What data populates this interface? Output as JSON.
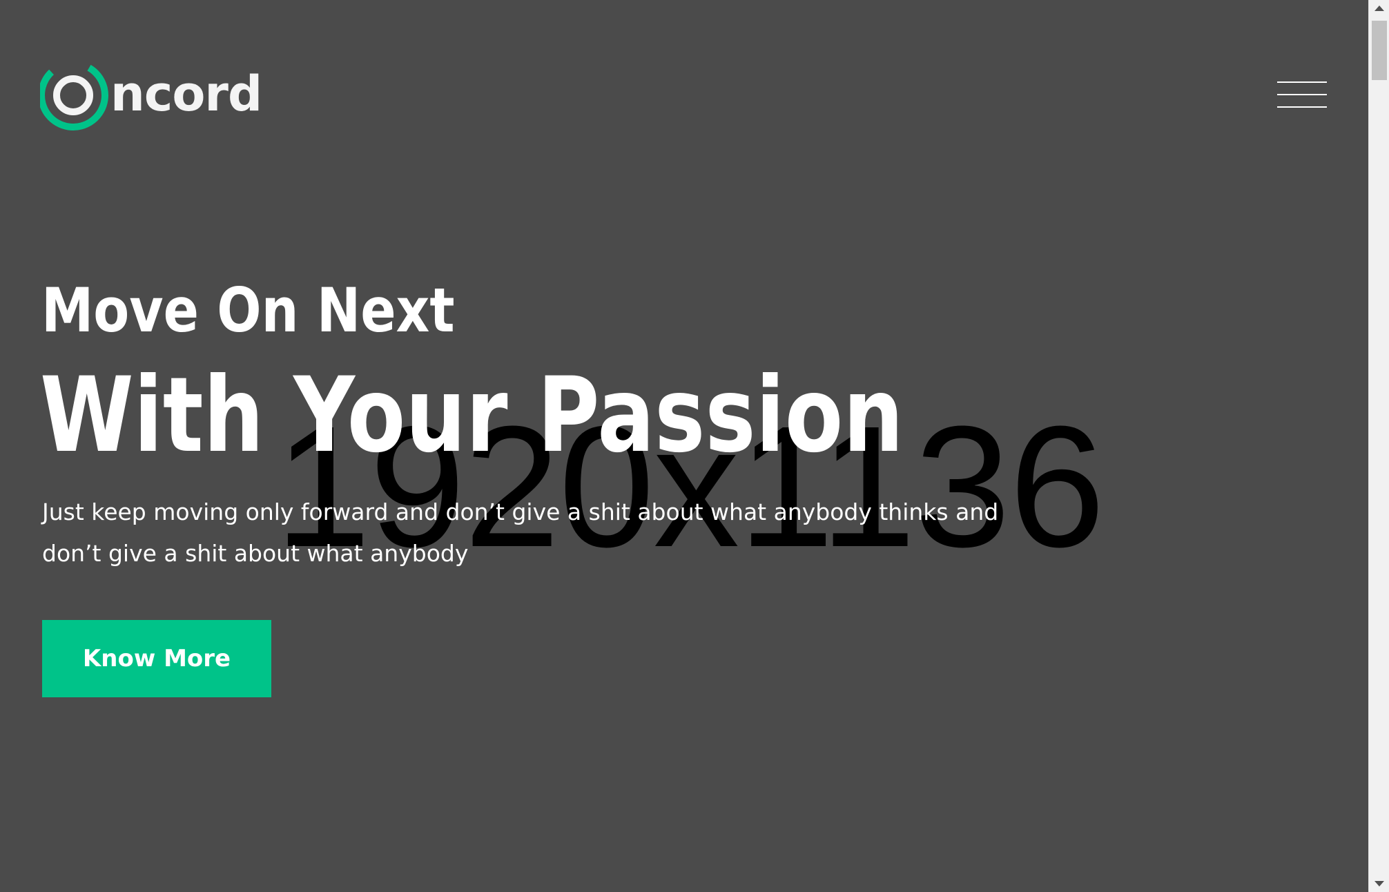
{
  "brand": {
    "name": "ncord",
    "accent_color": "#00c389",
    "logo_icon": "ring-logo-icon"
  },
  "header": {
    "menu_icon": "hamburger-menu-icon"
  },
  "hero": {
    "kicker": "Move On Next",
    "title": "With Your Passion",
    "description": "Just keep moving only forward and don’t give a shit about what anybody thinks and don’t give a shit about what anybody",
    "cta_label": "Know More",
    "background_color": "#4b4b4b"
  },
  "background_image": {
    "placeholder_text": "1920x1136"
  },
  "scrollbar": {
    "up_icon": "scroll-up-arrow-icon",
    "down_icon": "scroll-down-arrow-icon"
  }
}
